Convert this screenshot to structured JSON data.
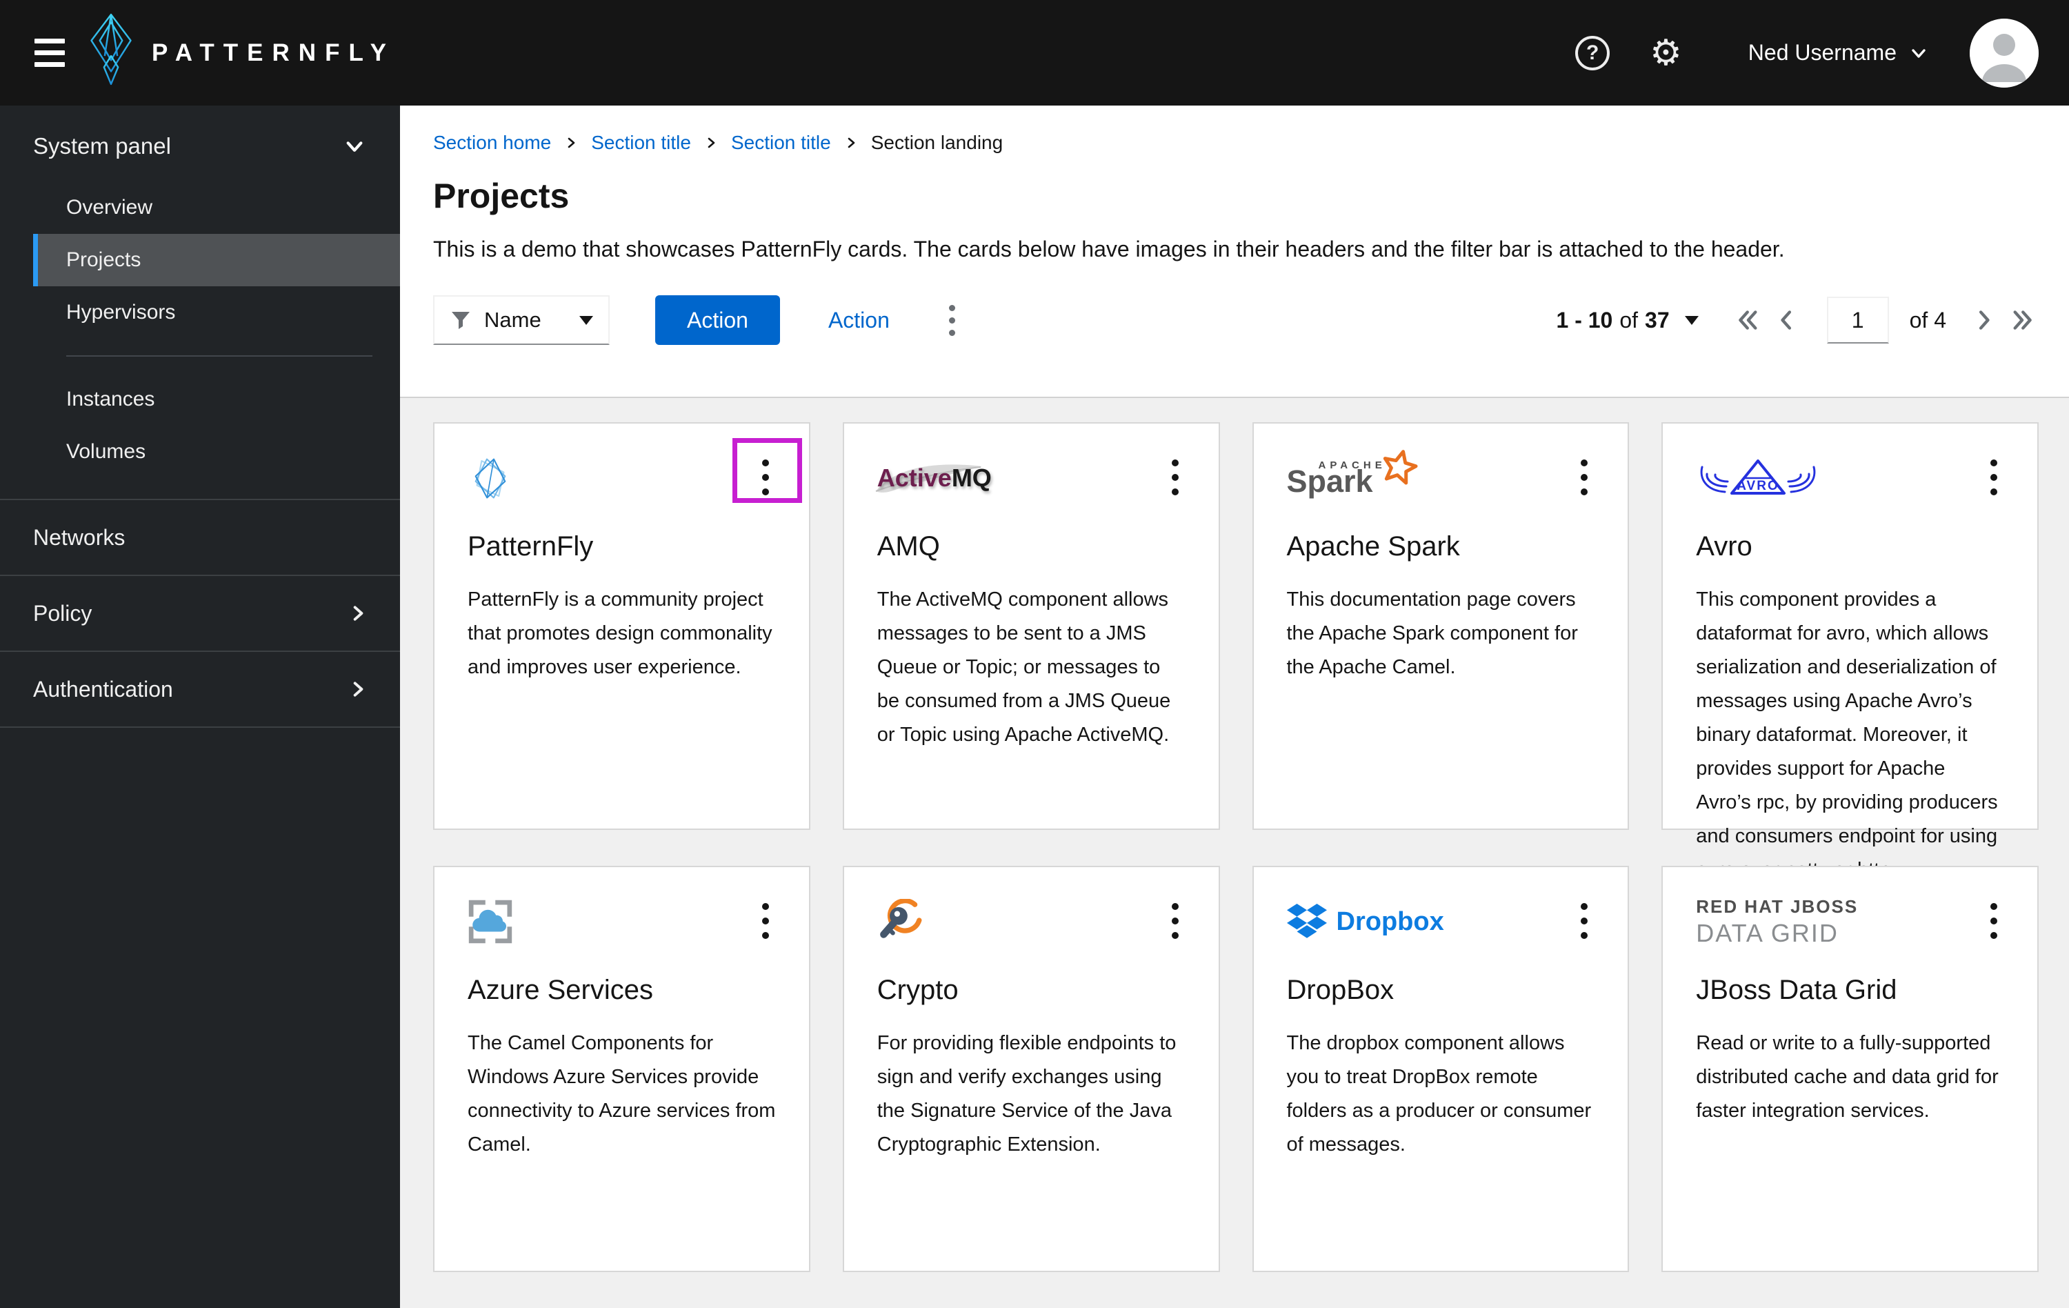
{
  "header": {
    "brand": "PATTERNFLY",
    "username": "Ned Username",
    "help_icon": "question-circle-icon",
    "settings_icon": "gear-icon"
  },
  "sidebar": {
    "panel_title": "System panel",
    "items": [
      {
        "label": "Overview",
        "selected": false
      },
      {
        "label": "Projects",
        "selected": true
      },
      {
        "label": "Hypervisors",
        "selected": false
      },
      {
        "label": "Instances",
        "selected": false
      },
      {
        "label": "Volumes",
        "selected": false
      }
    ],
    "sections": [
      {
        "label": "Networks",
        "expandable": false
      },
      {
        "label": "Policy",
        "expandable": true
      },
      {
        "label": "Authentication",
        "expandable": true
      }
    ]
  },
  "breadcrumb": {
    "items": [
      {
        "label": "Section home",
        "link": true
      },
      {
        "label": "Section title",
        "link": true
      },
      {
        "label": "Section title",
        "link": true
      },
      {
        "label": "Section landing",
        "link": false
      }
    ]
  },
  "page": {
    "title": "Projects",
    "description": "This is a demo that showcases PatternFly cards. The cards below have images in their headers and the filter bar is attached to the header."
  },
  "toolbar": {
    "filter_label": "Name",
    "primary_action_label": "Action",
    "link_action_label": "Action"
  },
  "pagination": {
    "range": "1 - 10",
    "of": "of",
    "total": "37",
    "current_page": "1",
    "page_of": "of 4"
  },
  "annotation": {
    "color": "#c71fd1",
    "target": "first-card-kebab-menu"
  },
  "colors": {
    "accent_blue": "#0066cc",
    "nav_selected_bg": "#4f5255",
    "nav_indicator": "#2b9af3",
    "masthead_bg": "#151515",
    "sidebar_bg": "#212427",
    "content_bg": "#f0f0f0"
  },
  "cards": [
    {
      "title": "PatternFly",
      "description": "PatternFly is a community project that promotes design commonality and improves user experience.",
      "logo": {
        "name": "patternfly-diamond-logo"
      }
    },
    {
      "title": "AMQ",
      "description": "The ActiveMQ component allows messages to be sent to a JMS Queue or Topic; or messages to be consumed from a JMS Queue or Topic using Apache ActiveMQ.",
      "logo": {
        "name": "activemq-logo",
        "active": "Active",
        "mq": "MQ"
      }
    },
    {
      "title": "Apache Spark",
      "description": "This documentation page covers the Apache Spark component for the Apache Camel.",
      "logo": {
        "name": "apache-spark-logo",
        "apache": "APACHE",
        "word": "Spark"
      }
    },
    {
      "title": "Avro",
      "description": "This component provides a dataformat for avro, which allows serialization and deserialization of messages using Apache Avro’s binary dataformat. Moreover, it provides support for Apache Avro’s rpc, by providing producers and consumers endpoint for using avro over netty or http.",
      "logo": {
        "name": "avro-wings-logo",
        "word": "AVRO"
      }
    },
    {
      "title": "Azure Services",
      "description": "The Camel Components for Windows Azure Services provide connectivity to Azure services from Camel.",
      "logo": {
        "name": "azure-cloud-logo"
      }
    },
    {
      "title": "Crypto",
      "description": "For providing flexible endpoints to sign and verify exchanges using the Signature Service of the Java Cryptographic Extension.",
      "logo": {
        "name": "crypto-key-logo"
      }
    },
    {
      "title": "DropBox",
      "description": "The dropbox component allows you to treat DropBox remote folders as a producer or consumer of messages.",
      "logo": {
        "name": "dropbox-logo",
        "word": "Dropbox"
      }
    },
    {
      "title": "JBoss Data Grid",
      "description": "Read or write to a fully-supported distributed cache and data grid for faster integration services.",
      "logo": {
        "name": "jboss-data-grid-logo",
        "line1": "RED HAT JBOSS",
        "line2": "DATA GRID"
      }
    }
  ]
}
